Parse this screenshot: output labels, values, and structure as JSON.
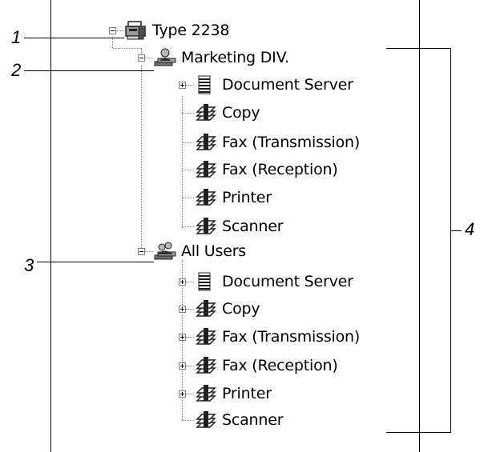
{
  "tree": {
    "root": {
      "label": "Type 2238",
      "callout": "1"
    },
    "groups": [
      {
        "label": "Marketing DIV.",
        "callout": "2",
        "items": [
          "Document Server",
          "Copy",
          "Fax (Transmission)",
          "Fax (Reception)",
          "Printer",
          "Scanner"
        ]
      },
      {
        "label": "All Users",
        "callout": "3",
        "items": [
          "Document Server",
          "Copy",
          "Fax (Transmission)",
          "Fax (Reception)",
          "Printer",
          "Scanner"
        ]
      }
    ],
    "bracket_callout": "4"
  },
  "icons": {
    "device": "printer-device-icon",
    "group": "user-group-icon",
    "document_server": "document-stack-icon",
    "function": "function-stack-icon"
  },
  "colors": {
    "line": "#000000",
    "tree_line": "#808080",
    "icon_dark": "#202020"
  }
}
